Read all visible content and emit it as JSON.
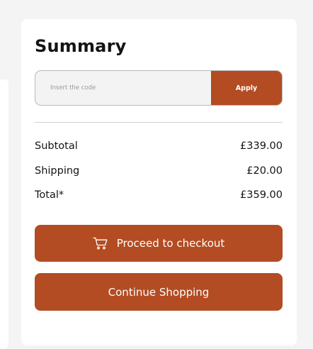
{
  "summary": {
    "title": "Summary",
    "promo": {
      "placeholder": "Insert the code",
      "apply_label": "Apply"
    },
    "rows": [
      {
        "label": "Subtotal",
        "value": "£339.00"
      },
      {
        "label": "Shipping",
        "value": "£20.00"
      },
      {
        "label": "Total*",
        "value": "£359.00"
      }
    ],
    "checkout_label": "Proceed to checkout",
    "checkout_icon": "cart-icon",
    "continue_label": "Continue Shopping"
  },
  "colors": {
    "accent": "#b34c22",
    "background": "#f4f4f4",
    "card": "#ffffff"
  }
}
